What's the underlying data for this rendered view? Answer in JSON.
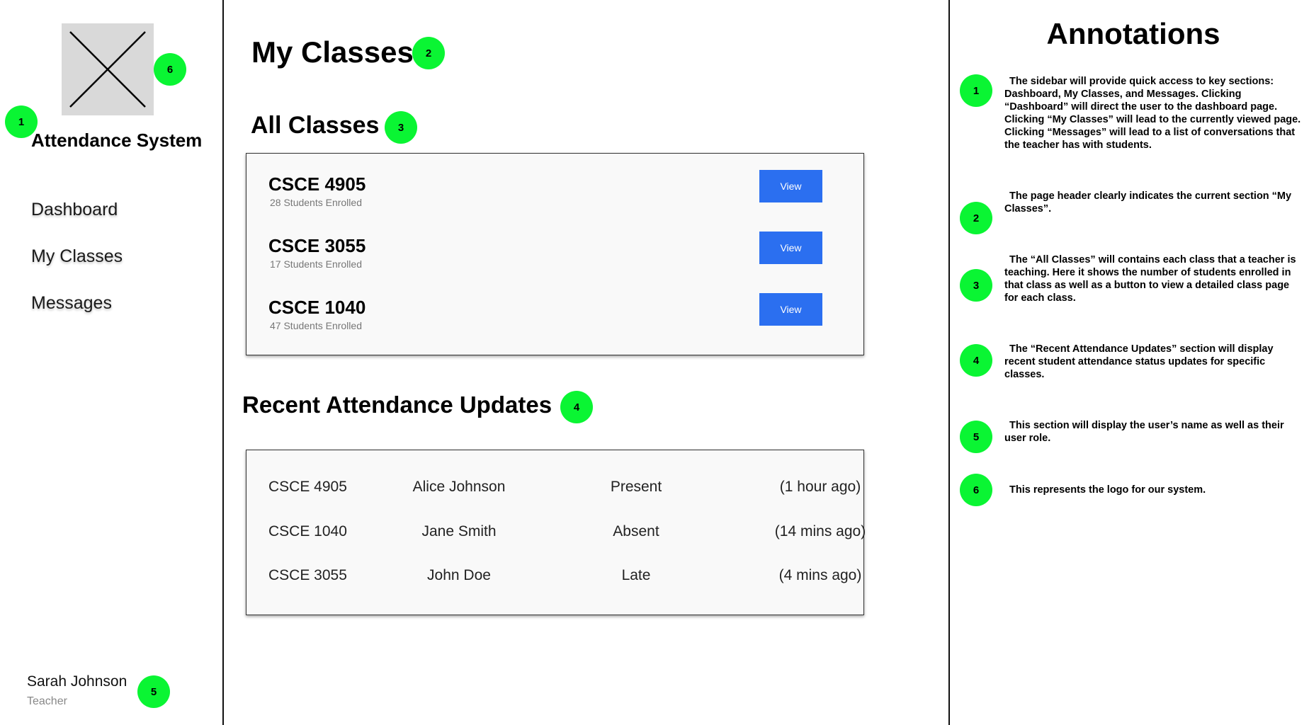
{
  "sidebar": {
    "app_title": "Attendance System",
    "nav": [
      {
        "label": "Dashboard"
      },
      {
        "label": "My Classes"
      },
      {
        "label": "Messages"
      }
    ],
    "user": {
      "name": "Sarah Johnson",
      "role": "Teacher"
    }
  },
  "main": {
    "page_title": "My Classes",
    "all_classes_title": "All Classes",
    "classes": [
      {
        "code": "CSCE 4905",
        "enrolled": "28 Students Enrolled",
        "button": "View"
      },
      {
        "code": "CSCE 3055",
        "enrolled": "17 Students Enrolled",
        "button": "View"
      },
      {
        "code": "CSCE 1040",
        "enrolled": "47 Students Enrolled",
        "button": "View"
      }
    ],
    "updates_title": "Recent Attendance Updates",
    "updates": [
      {
        "class": "CSCE 4905",
        "student": "Alice Johnson",
        "status": "Present",
        "time": "(1 hour ago)"
      },
      {
        "class": "CSCE 1040",
        "student": "Jane Smith",
        "status": "Absent",
        "time": "(14 mins ago)"
      },
      {
        "class": "CSCE 3055",
        "student": "John Doe",
        "status": "Late",
        "time": "(4 mins ago)"
      }
    ]
  },
  "annotations": {
    "title": "Annotations",
    "items": [
      {
        "number": "1",
        "text": "The sidebar will provide quick access to key sections: Dashboard, My Classes, and Messages.  Clicking “Dashboard” will direct the user to the dashboard page. Clicking “My Classes” will lead to the currently viewed page. Clicking “Messages” will lead to a list of conversations that the teacher has with students."
      },
      {
        "number": "2",
        "text": "The page header clearly indicates the current section “My Classes”."
      },
      {
        "number": "3",
        "text": "The “All Classes” will contains each class that a teacher is teaching. Here it shows the number of students enrolled in that class as well as a button to view a detailed class page for each class."
      },
      {
        "number": "4",
        "text": "The “Recent Attendance Updates” section will display recent student attendance status updates for specific classes."
      },
      {
        "number": "5",
        "text": "This section will display the user’s name as well as their user role."
      },
      {
        "number": "6",
        "text": "This represents the logo for our system."
      }
    ]
  },
  "colors": {
    "badge": "#0af533",
    "button": "#2b6ff0",
    "logo_placeholder": "#d9d9d9"
  }
}
